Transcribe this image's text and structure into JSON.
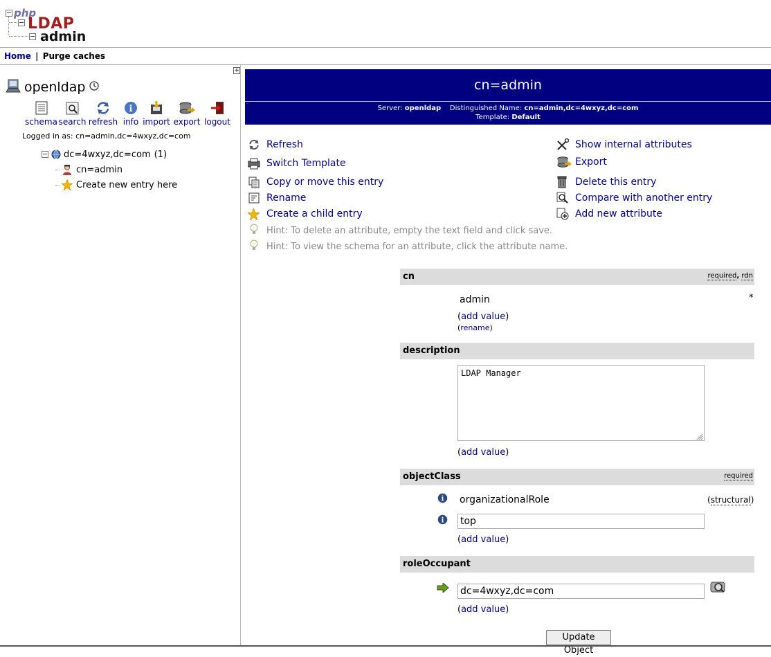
{
  "logo": {
    "php": "php",
    "ldap": "LDAP",
    "admin": "admin"
  },
  "topnav": {
    "home": "Home",
    "separator": "|",
    "purge": "Purge caches"
  },
  "server": {
    "name": "openldap"
  },
  "tools": [
    {
      "label": "schema",
      "icon": "schema-icon"
    },
    {
      "label": "search",
      "icon": "search-icon"
    },
    {
      "label": "refresh",
      "icon": "refresh-icon"
    },
    {
      "label": "info",
      "icon": "info-icon"
    },
    {
      "label": "import",
      "icon": "import-icon"
    },
    {
      "label": "export",
      "icon": "export-icon"
    },
    {
      "label": "logout",
      "icon": "logout-icon"
    }
  ],
  "logged_in": "Logged in as: cn=admin,dc=4wxyz,dc=com",
  "tree": {
    "root": "dc=4wxyz,dc=com",
    "root_count": "(1)",
    "child": "cn=admin",
    "create": "Create new entry here"
  },
  "entry": {
    "title": "cn=admin",
    "server_label": "Server:",
    "server": "openldap",
    "dn_label": "Distinguished Name:",
    "dn": "cn=admin,dc=4wxyz,dc=com",
    "template_label": "Template:",
    "template": "Default"
  },
  "actions_left": [
    "Refresh",
    "Switch Template",
    "Copy or move this entry",
    "Rename",
    "Create a child entry"
  ],
  "actions_right": [
    "Show internal attributes",
    "Export",
    "Delete this entry",
    "Compare with another entry",
    "Add new attribute"
  ],
  "hints": [
    "Hint: To delete an attribute, empty the text field and click save.",
    "Hint: To view the schema for an attribute, click the attribute name."
  ],
  "attrs": {
    "cn": {
      "name": "cn",
      "flag1": "required",
      "flag_sep": ",",
      "flag2": "rdn",
      "value": "admin",
      "star": "*",
      "add": "add value",
      "rename": "rename"
    },
    "description": {
      "name": "description",
      "value": "LDAP Manager",
      "add": "add value"
    },
    "objectClass": {
      "name": "objectClass",
      "flag1": "required",
      "value1": "organizationalRole",
      "structural": "structural",
      "value2": "top",
      "add": "add value"
    },
    "roleOccupant": {
      "name": "roleOccupant",
      "value": "dc=4wxyz,dc=com",
      "add": "add value"
    }
  },
  "update_button": "Update Object"
}
